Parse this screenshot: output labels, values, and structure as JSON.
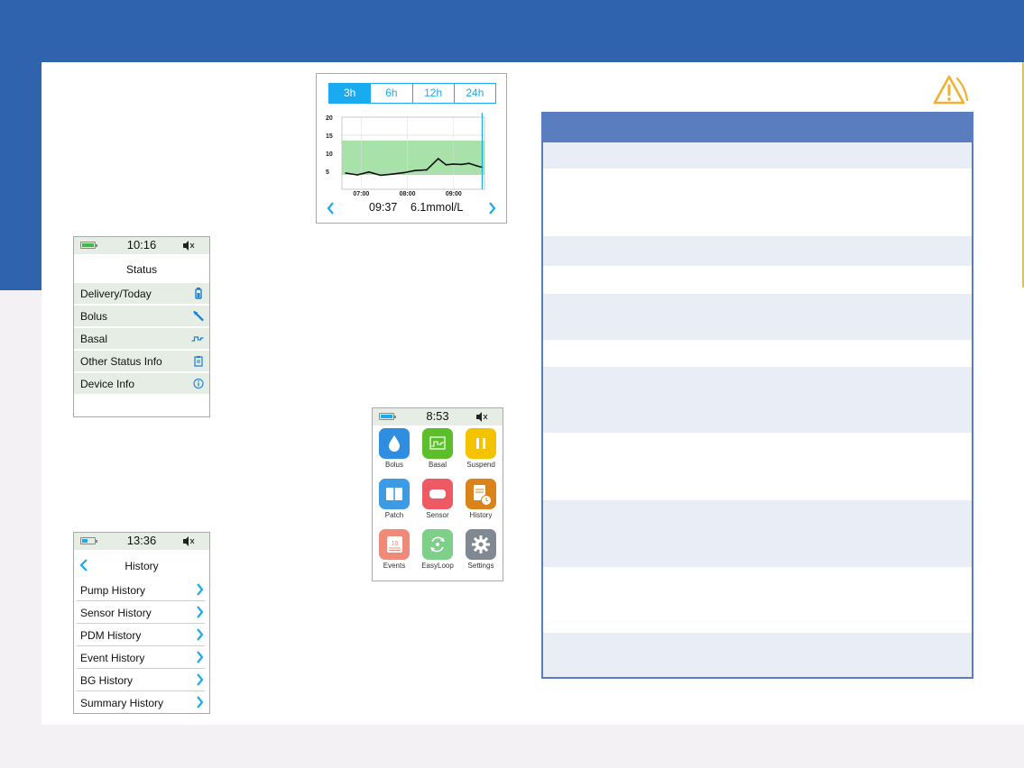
{
  "colors": {
    "brand_blue": "#2f63ae",
    "accent_cyan": "#1aaaf0",
    "screen_gray": "#e5ede5",
    "table_header": "#5a7dbf",
    "table_row": "#e8edf6",
    "warning": "#f2b030"
  },
  "status_screen": {
    "time": "10:16",
    "title": "Status",
    "items": [
      {
        "label": "Delivery/Today",
        "icon": "vial-icon"
      },
      {
        "label": "Bolus",
        "icon": "syringe-icon"
      },
      {
        "label": "Basal",
        "icon": "basal-wave-icon"
      },
      {
        "label": "Other Status Info",
        "icon": "clipboard-icon"
      },
      {
        "label": "Device Info",
        "icon": "info-icon"
      }
    ]
  },
  "history_screen": {
    "time": "13:36",
    "title": "History",
    "items": [
      {
        "label": "Pump History"
      },
      {
        "label": "Sensor History"
      },
      {
        "label": "PDM History"
      },
      {
        "label": "Event History"
      },
      {
        "label": "BG History"
      },
      {
        "label": "Summary History"
      }
    ]
  },
  "home_screen": {
    "time": "8:53",
    "apps": [
      {
        "label": "Bolus",
        "icon": "drop-icon",
        "color": "#2f8ee0"
      },
      {
        "label": "Basal",
        "icon": "basal-chart-icon",
        "color": "#5cbf2a"
      },
      {
        "label": "Suspend",
        "icon": "pause-icon",
        "color": "#f3c300"
      },
      {
        "label": "Patch",
        "icon": "patch-icon",
        "color": "#3d9be4"
      },
      {
        "label": "Sensor",
        "icon": "sensor-icon",
        "color": "#ee5a63"
      },
      {
        "label": "History",
        "icon": "history-icon",
        "color": "#d9831a"
      },
      {
        "label": "Events",
        "icon": "calendar-icon",
        "color": "#f08a78"
      },
      {
        "label": "EasyLoop",
        "icon": "loop-icon",
        "color": "#7dcf8a"
      },
      {
        "label": "Settings",
        "icon": "gear-icon",
        "color": "#808891"
      }
    ]
  },
  "cgm_screen": {
    "tabs": [
      "3h",
      "6h",
      "12h",
      "24h"
    ],
    "active_tab": "3h",
    "time": "09:37",
    "value": "6.1mmol/L"
  },
  "chart_data": {
    "type": "line",
    "title": "",
    "xlabel": "",
    "ylabel": "",
    "y_ticks": [
      "20",
      "15",
      "10",
      "5"
    ],
    "x_ticks": [
      "07:00",
      "08:00",
      "09:00"
    ],
    "ylim": [
      0,
      20
    ],
    "target_range": [
      4.0,
      13.5
    ],
    "series": [
      {
        "x": [
          "06:40",
          "06:55",
          "07:10",
          "07:25",
          "07:40",
          "07:55",
          "08:10",
          "08:25",
          "08:40",
          "08:50",
          "09:00",
          "09:10",
          "09:20",
          "09:30",
          "09:37"
        ],
        "y": [
          4.5,
          4.0,
          4.8,
          3.9,
          4.2,
          4.6,
          5.2,
          5.4,
          8.5,
          6.8,
          7.0,
          6.9,
          7.2,
          6.5,
          6.1
        ]
      }
    ]
  }
}
